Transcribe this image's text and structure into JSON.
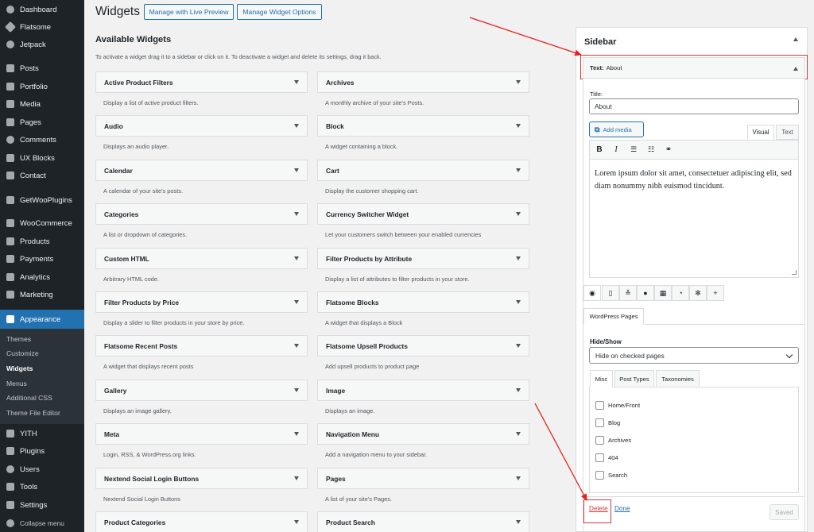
{
  "menu": {
    "items": [
      {
        "label": "Dashboard",
        "icon": "dashboard-icon"
      },
      {
        "label": "Flatsome",
        "icon": "flatsome-icon"
      },
      {
        "label": "Jetpack",
        "icon": "jetpack-icon"
      },
      {
        "label": "Posts",
        "icon": "pin-icon"
      },
      {
        "label": "Portfolio",
        "icon": "portfolio-icon"
      },
      {
        "label": "Media",
        "icon": "media-icon"
      },
      {
        "label": "Pages",
        "icon": "pages-icon"
      },
      {
        "label": "Comments",
        "icon": "comments-icon"
      },
      {
        "label": "UX Blocks",
        "icon": "blocks-icon"
      },
      {
        "label": "Contact",
        "icon": "mail-icon"
      },
      {
        "label": "GetWooPlugins",
        "icon": "plugin-grid-icon"
      },
      {
        "label": "WooCommerce",
        "icon": "woocommerce-icon"
      },
      {
        "label": "Products",
        "icon": "products-icon"
      },
      {
        "label": "Payments",
        "icon": "payments-icon"
      },
      {
        "label": "Analytics",
        "icon": "analytics-icon"
      },
      {
        "label": "Marketing",
        "icon": "megaphone-icon"
      },
      {
        "label": "Appearance",
        "icon": "brush-icon"
      },
      {
        "label": "YITH",
        "icon": "yith-icon"
      },
      {
        "label": "Plugins",
        "icon": "plugins-icon"
      },
      {
        "label": "Users",
        "icon": "users-icon"
      },
      {
        "label": "Tools",
        "icon": "wrench-icon"
      },
      {
        "label": "Settings",
        "icon": "settings-icon"
      },
      {
        "label": "Collapse menu",
        "icon": "collapse-icon"
      }
    ],
    "submenu": [
      "Themes",
      "Customize",
      "Widgets",
      "Menus",
      "Additional CSS",
      "Theme File Editor"
    ]
  },
  "header": {
    "title": "Widgets",
    "live_preview": "Manage with Live Preview",
    "widget_options": "Manage Widget Options"
  },
  "available": {
    "heading": "Available Widgets",
    "description": "To activate a widget drag it to a sidebar or click on it. To deactivate a widget and delete its settings, drag it back.",
    "left": [
      {
        "name": "Active Product Filters",
        "desc": "Display a list of active product filters."
      },
      {
        "name": "Audio",
        "desc": "Displays an audio player."
      },
      {
        "name": "Calendar",
        "desc": "A calendar of your site's posts."
      },
      {
        "name": "Categories",
        "desc": "A list or dropdown of categories."
      },
      {
        "name": "Custom HTML",
        "desc": "Arbitrary HTML code."
      },
      {
        "name": "Filter Products by Price",
        "desc": "Display a slider to filter products in your store by price."
      },
      {
        "name": "Flatsome Recent Posts",
        "desc": "A widget that displays recent posts"
      },
      {
        "name": "Gallery",
        "desc": "Displays an image gallery."
      },
      {
        "name": "Meta",
        "desc": "Login, RSS, & WordPress.org links."
      },
      {
        "name": "Nextend Social Login Buttons",
        "desc": "Nextend Social Login Buttons"
      },
      {
        "name": "Product Categories",
        "desc": ""
      }
    ],
    "right": [
      {
        "name": "Archives",
        "desc": "A monthly archive of your site's Posts."
      },
      {
        "name": "Block",
        "desc": "A widget containing a block."
      },
      {
        "name": "Cart",
        "desc": "Display the customer shopping cart."
      },
      {
        "name": "Currency Switcher Widget",
        "desc": "Let your customers switch between your enabled currencies"
      },
      {
        "name": "Filter Products by Attribute",
        "desc": "Display a list of attributes to filter products in your store."
      },
      {
        "name": "Flatsome Blocks",
        "desc": "A widget that displays a Block"
      },
      {
        "name": "Flatsome Upsell Products",
        "desc": "Add upsell products to product page"
      },
      {
        "name": "Image",
        "desc": "Displays an image."
      },
      {
        "name": "Navigation Menu",
        "desc": "Add a navigation menu to your sidebar."
      },
      {
        "name": "Pages",
        "desc": "A list of your site's Pages."
      },
      {
        "name": "Product Search",
        "desc": ""
      }
    ]
  },
  "sidebar": {
    "title": "Sidebar",
    "widget": {
      "type": "Text:",
      "name": "About",
      "title_label": "Title:",
      "title_value": "About",
      "add_media": "Add media",
      "tab_visual": "Visual",
      "tab_text": "Text",
      "toolbar": {
        "bold": "B",
        "italic": "I"
      },
      "content": "Lorem ipsum dolor sit amet, consectetuer adipiscing elit, sed diam nonummy nibh euismod tincidunt.",
      "wp_pages_tab": "WordPress Pages",
      "hideshow_label": "Hide/Show",
      "hideshow_value": "Hide on checked pages",
      "subtabs": [
        "Misc",
        "Post Types",
        "Taxonomies"
      ],
      "checkboxes": [
        "Home/Front",
        "Blog",
        "Archives",
        "404",
        "Search"
      ],
      "delete": "Delete",
      "done": "Done",
      "saved": "Saved"
    }
  },
  "colors": {
    "accent": "#2271b1",
    "danger": "#d63638",
    "menu_bg": "#1d2327"
  }
}
